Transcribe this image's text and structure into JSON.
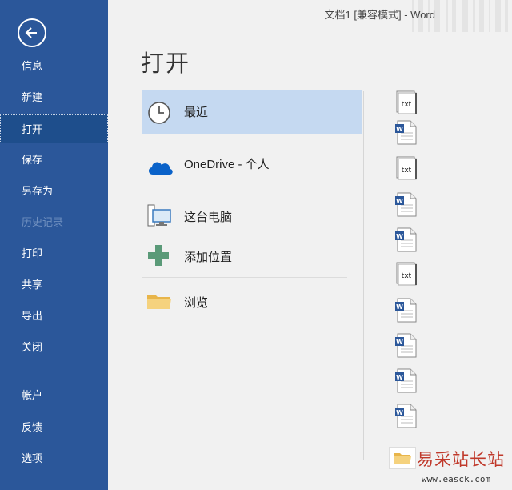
{
  "window": {
    "title": "文档1 [兼容模式]  -  Word"
  },
  "sidebar": {
    "items": [
      {
        "label": "信息"
      },
      {
        "label": "新建"
      },
      {
        "label": "打开"
      },
      {
        "label": "保存"
      },
      {
        "label": "另存为"
      },
      {
        "label": "历史记录"
      },
      {
        "label": "打印"
      },
      {
        "label": "共享"
      },
      {
        "label": "导出"
      },
      {
        "label": "关闭"
      },
      {
        "label": "帐户"
      },
      {
        "label": "反馈"
      },
      {
        "label": "选项"
      }
    ],
    "active": "打开",
    "disabled": "历史记录"
  },
  "main": {
    "title": "打开",
    "locations": [
      {
        "label": "最近",
        "icon": "clock-icon",
        "selected": true
      },
      {
        "label": "OneDrive - 个人",
        "icon": "onedrive-cloud-icon"
      },
      {
        "label": "这台电脑",
        "icon": "computer-icon"
      },
      {
        "label": "添加位置",
        "icon": "plus-icon"
      },
      {
        "label": "浏览",
        "icon": "folder-icon"
      }
    ],
    "files": [
      {
        "type": "txt",
        "badge": "txt"
      },
      {
        "type": "word",
        "badge": "W"
      },
      {
        "type": "txt",
        "badge": "txt"
      },
      {
        "type": "word",
        "badge": "W"
      },
      {
        "type": "word",
        "badge": "W"
      },
      {
        "type": "txt",
        "badge": "txt"
      },
      {
        "type": "word",
        "badge": "W"
      },
      {
        "type": "word",
        "badge": "W"
      },
      {
        "type": "word",
        "badge": "W"
      },
      {
        "type": "word",
        "badge": "W"
      }
    ]
  },
  "watermark": {
    "text": "易采站长站",
    "url": "www.easck.com"
  },
  "colors": {
    "sidebar": "#2b579a",
    "selected": "#c5d9f1",
    "word_blue": "#2b579a",
    "plus_green": "#5a9a78",
    "folder": "#f0c96a"
  }
}
